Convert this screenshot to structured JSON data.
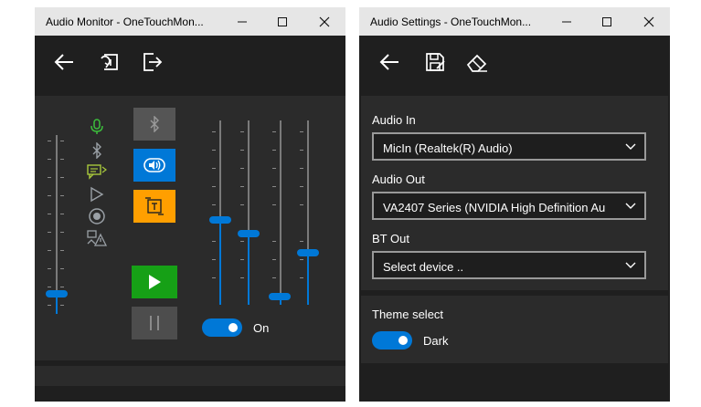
{
  "monitor": {
    "title": "Audio Monitor - OneTouchMon...",
    "toggle_label": "On",
    "colors": {
      "accent": "#0078d7",
      "play": "#16a016",
      "tts": "#ff9f00"
    }
  },
  "settings": {
    "title": "Audio Settings - OneTouchMon...",
    "audio_in_label": "Audio In",
    "audio_in_value": "MicIn (Realtek(R) Audio)",
    "audio_out_label": "Audio Out",
    "audio_out_value": "VA2407 Series (NVIDIA High Definition Au",
    "bt_out_label": "BT Out",
    "bt_out_value": "Select device ..",
    "theme_label": "Theme select",
    "theme_value": "Dark"
  }
}
